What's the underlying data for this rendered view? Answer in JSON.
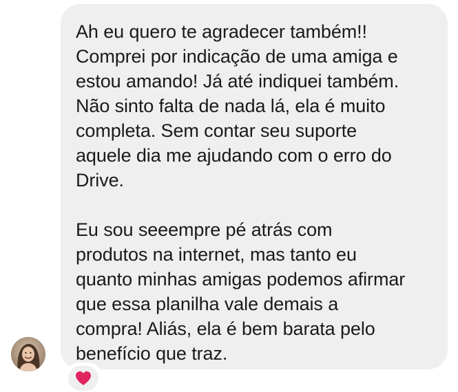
{
  "message": {
    "paragraphs": [
      {
        "lines": [
          "Ah eu quero te agradecer também!!",
          "Comprei por indicação de uma amiga e",
          "estou amando! Já até indiquei também.",
          "Não sinto falta de nada lá, ela é muito",
          "completa. Sem contar seu suporte",
          "aquele dia me ajudando com o erro do",
          "Drive."
        ]
      },
      {
        "lines": [
          "Eu sou seeempre pé atrás com",
          "produtos na internet, mas tanto eu",
          "quanto minhas amigas podemos afirmar",
          "que essa planilha vale demais a",
          "compra! Aliás, ela é bem barata pelo",
          "benefício que traz."
        ]
      }
    ]
  },
  "sender": {
    "avatar_icon": "user-avatar-photo"
  },
  "reaction": {
    "icon": "red-heart-icon",
    "color": "#e0245e"
  },
  "colors": {
    "bubble": "#efefef",
    "text": "#1a1a1a",
    "background": "#ffffff"
  }
}
